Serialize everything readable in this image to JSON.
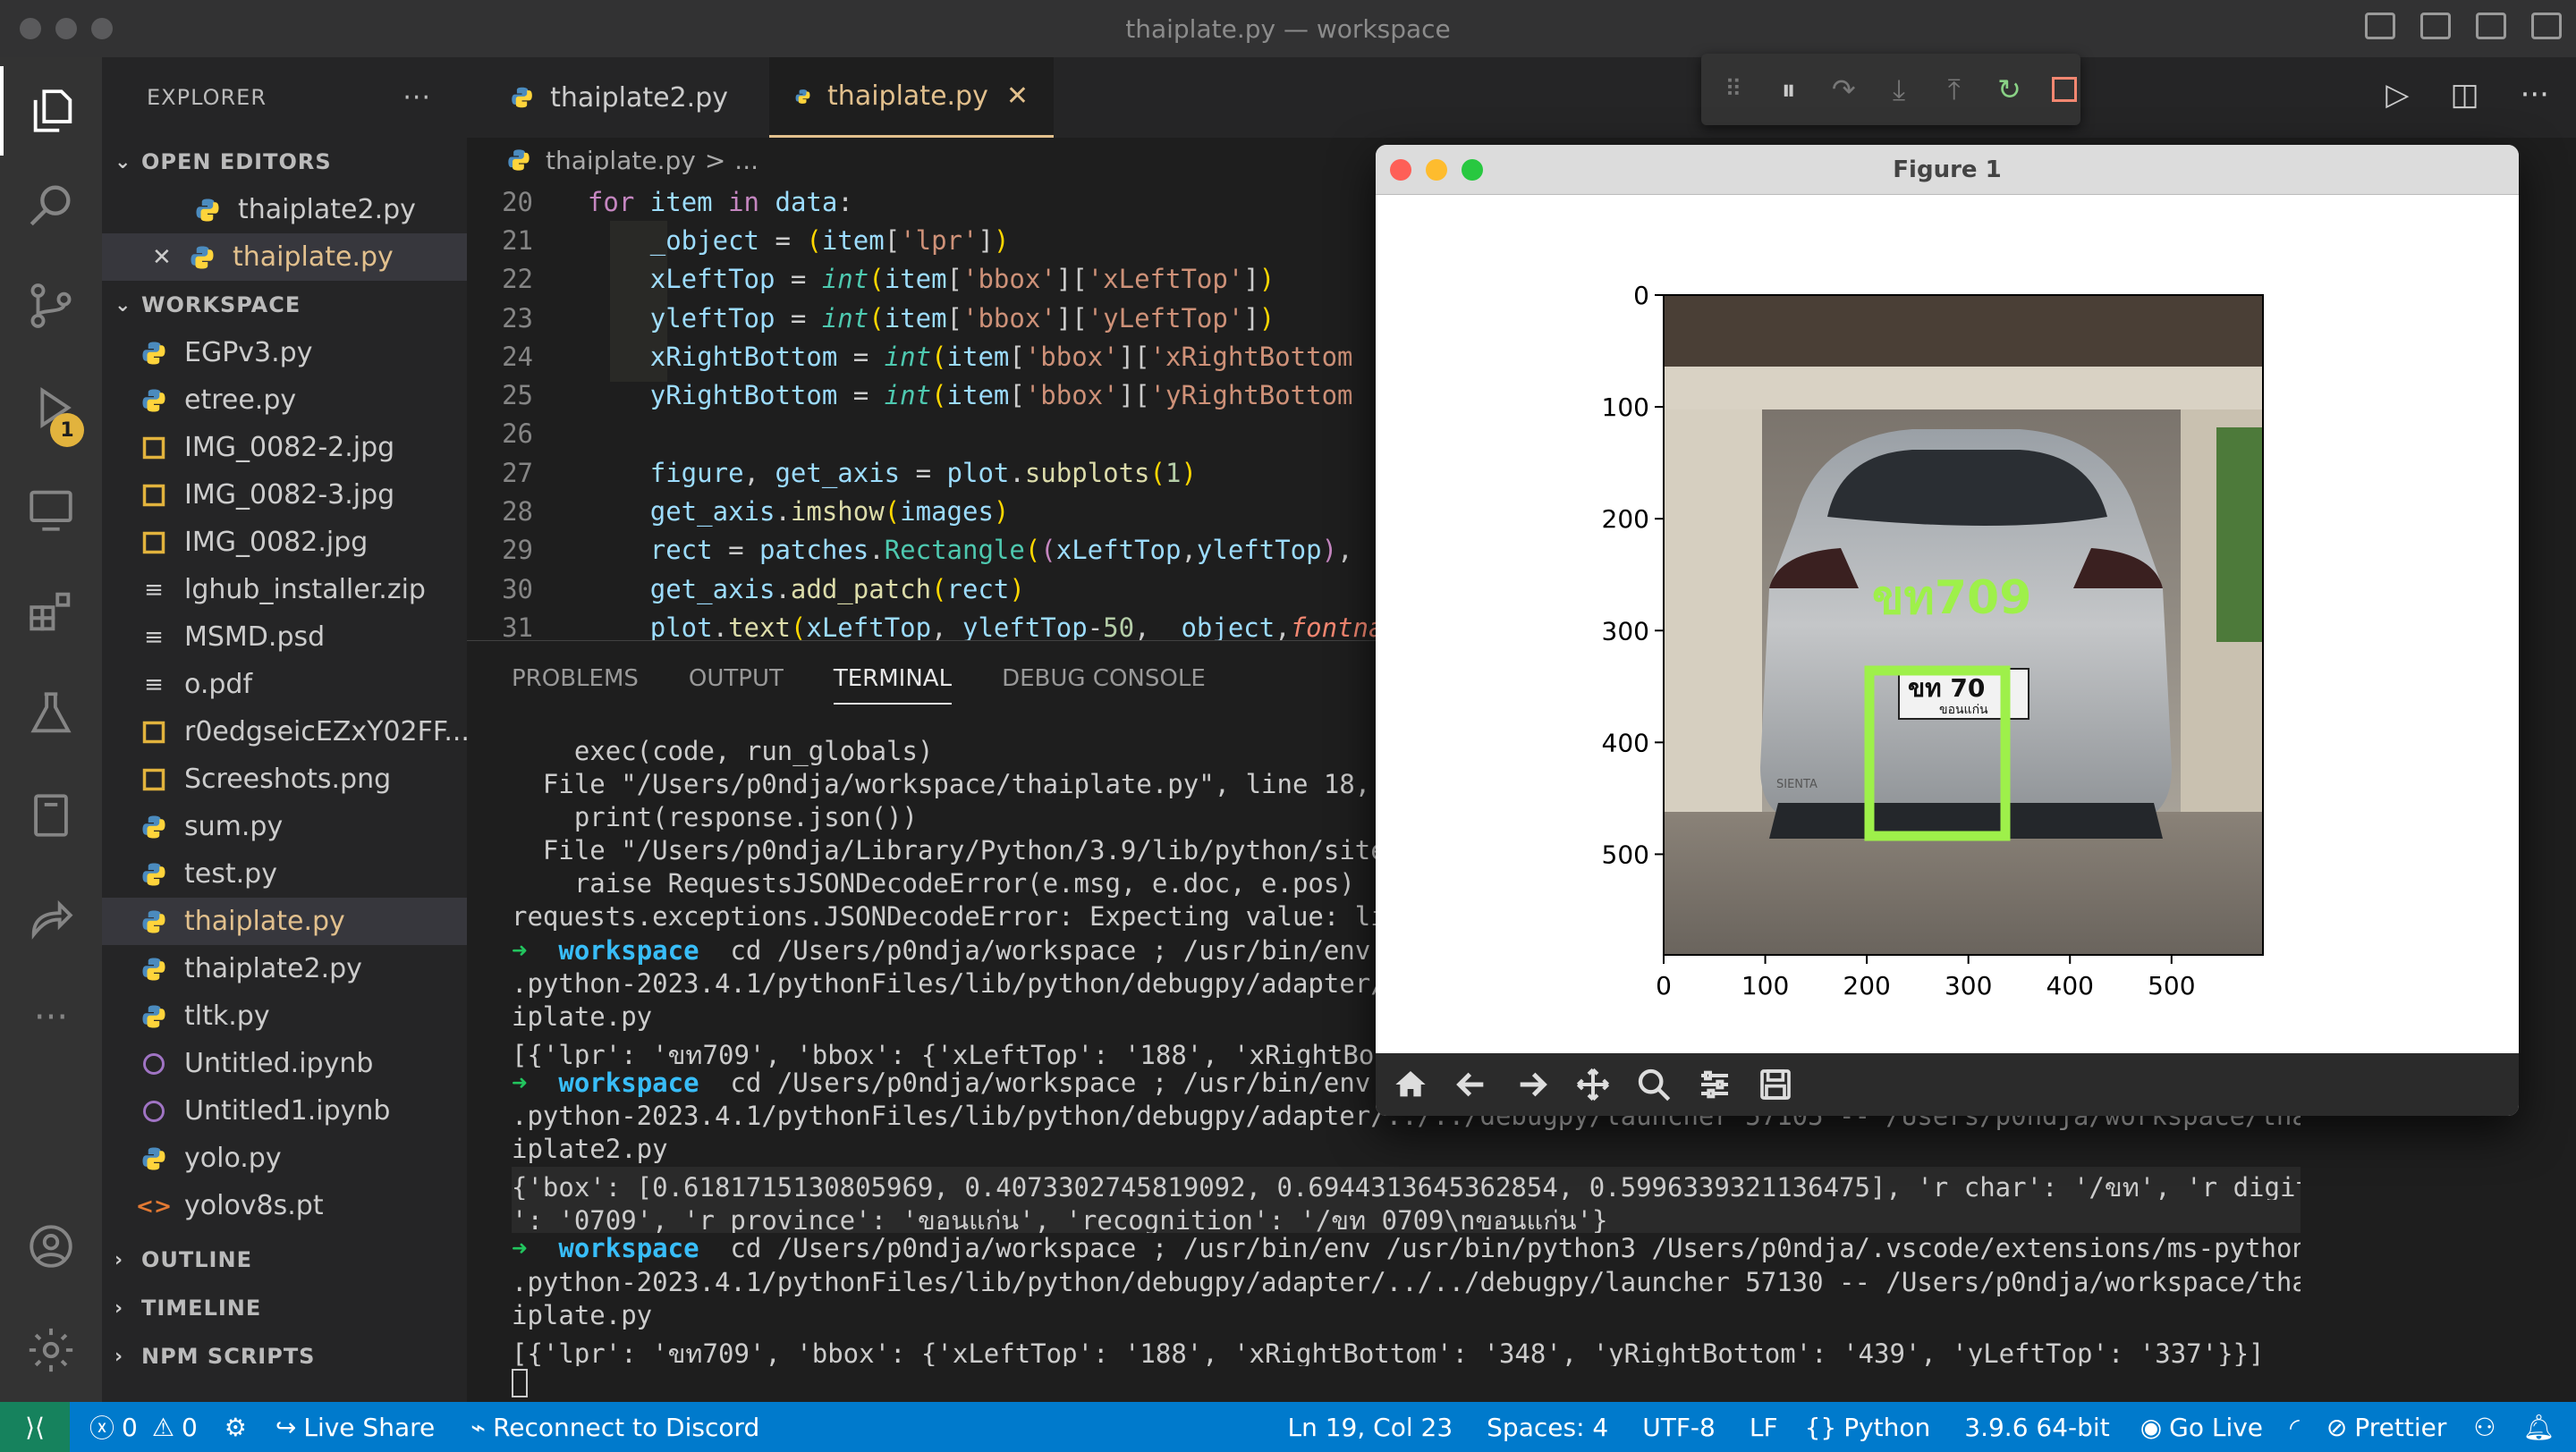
{
  "window": {
    "title": "thaiplate.py — workspace"
  },
  "activity": {
    "debug_badge": "1"
  },
  "sidebar": {
    "title": "EXPLORER",
    "more": "···",
    "open_editors_label": "OPEN EDITORS",
    "open_editors": [
      {
        "name": "thaiplate2.py",
        "icon": "python-icon"
      },
      {
        "name": "thaiplate.py",
        "icon": "python-icon",
        "close": "✕"
      }
    ],
    "workspace_label": "WORKSPACE",
    "files": [
      {
        "name": "EGPv3.py",
        "icon": "python-icon"
      },
      {
        "name": "etree.py",
        "icon": "python-icon"
      },
      {
        "name": "IMG_0082-2.jpg",
        "icon": "image-icon"
      },
      {
        "name": "IMG_0082-3.jpg",
        "icon": "image-icon"
      },
      {
        "name": "IMG_0082.jpg",
        "icon": "image-icon"
      },
      {
        "name": "lghub_installer.zip",
        "icon": "zip-icon"
      },
      {
        "name": "MSMD.psd",
        "icon": "file-icon"
      },
      {
        "name": "o.pdf",
        "icon": "file-icon"
      },
      {
        "name": "r0edgseicEZxY02FF...",
        "icon": "image-icon"
      },
      {
        "name": "Screeshots.png",
        "icon": "image-icon"
      },
      {
        "name": "sum.py",
        "icon": "python-icon"
      },
      {
        "name": "test.py",
        "icon": "python-icon"
      },
      {
        "name": "thaiplate.py",
        "icon": "python-icon"
      },
      {
        "name": "thaiplate2.py",
        "icon": "python-icon"
      },
      {
        "name": "tltk.py",
        "icon": "python-icon"
      },
      {
        "name": "Untitled.ipynb",
        "icon": "notebook-icon"
      },
      {
        "name": "Untitled1.ipynb",
        "icon": "notebook-icon"
      },
      {
        "name": "yolo.py",
        "icon": "python-icon"
      },
      {
        "name": "yolov8s.pt",
        "icon": "code-file-icon"
      }
    ],
    "outline_label": "OUTLINE",
    "timeline_label": "TIMELINE",
    "npm_label": "NPM SCRIPTS"
  },
  "tabs": [
    {
      "label": "thaiplate2.py"
    },
    {
      "label": "thaiplate.py",
      "close": "✕"
    }
  ],
  "breadcrumb": {
    "file": "thaiplate.py",
    "sep": ">",
    "more": "..."
  },
  "code_numbers": [
    "20",
    "21",
    "22",
    "23",
    "24",
    "25",
    "26",
    "27",
    "28",
    "29",
    "30",
    "31"
  ],
  "panel": {
    "tabs": [
      "PROBLEMS",
      "OUTPUT",
      "TERMINAL",
      "DEBUG CONSOLE"
    ]
  },
  "terminal": [
    "    exec(code, run_globals)",
    "  File \"/Users/p0ndja/workspace/thaiplate.py\", line 18, in <module>",
    "    print(response.json())",
    "  File \"/Users/p0ndja/Library/Python/3.9/lib/python/site-packages/requests/models.py\"",
    "    raise RequestsJSONDecodeError(e.msg, e.doc, e.pos)",
    "requests.exceptions.JSONDecodeError: Expecting value: line 1 column 1 (char 0)",
    "@@workspace  cd /Users/p0ndja/workspace ; /usr/bin/env /usr/bin/python3 /Users/p0ndja/.vscode/extensions/ms-python",
    ".python-2023.4.1/pythonFiles/lib/python/debugpy/adapter/../../debugpy/launcher 57105 -- /Users/p0ndja/workspace/tha",
    "iplate.py",
    "[{'lpr': 'ขท709', 'bbox': {'xLeftTop': '188', 'xRightBottom': '348', 'yRightBottom': '439', 'yLeftTop': '337'}}]",
    "@@workspace  cd /Users/p0ndja/workspace ; /usr/bin/env /usr/bin/python3 /Users/p0ndja/.vscode/extensions/ms-python",
    ".python-2023.4.1/pythonFiles/lib/python/debugpy/adapter/../../debugpy/launcher 57105 -- /Users/p0ndja/workspace/tha",
    "iplate2.py",
    "{'box': [0.6181715130805969, 0.4073302745819092, 0.6944313645362854, 0.5996339321136475], 'r_char': '/ขท', 'r_digit",
    "': '0709', 'r_province': 'ขอนแก่น', 'recognition': '/ขท 0709\\nขอนแก่น'}",
    "@@workspace  cd /Users/p0ndja/workspace ; /usr/bin/env /usr/bin/python3 /Users/p0ndja/.vscode/extensions/ms-python",
    ".python-2023.4.1/pythonFiles/lib/python/debugpy/adapter/../../debugpy/launcher 57130 -- /Users/p0ndja/workspace/tha",
    "iplate.py",
    "[{'lpr': 'ขท709', 'bbox': {'xLeftTop': '188', 'xRightBottom': '348', 'yRightBottom': '439', 'yLeftTop': '337'}}]"
  ],
  "prompt_word": "workspace",
  "prompt_arrow": "➜",
  "figure": {
    "title": "Figure 1",
    "plate_text": "ขท709",
    "plate_label_top": "ขท 70",
    "plate_label_bottom": "ขอนแก่น",
    "brand": "SIENTA",
    "y_ticks": [
      "0",
      "100",
      "200",
      "300",
      "400",
      "500"
    ],
    "x_ticks": [
      "0",
      "100",
      "200",
      "300",
      "400",
      "500"
    ],
    "accent": "#9ef04a"
  },
  "status": {
    "errors": "0",
    "warnings": "0",
    "live_share": "Live Share",
    "discord": "Reconnect to Discord",
    "position": "Ln 19, Col 23",
    "spaces": "Spaces: 4",
    "encoding": "UTF-8",
    "eol": "LF",
    "language": "Python",
    "interpreter": "3.9.6 64-bit",
    "go_live": "Go Live",
    "prettier": "Prettier"
  }
}
